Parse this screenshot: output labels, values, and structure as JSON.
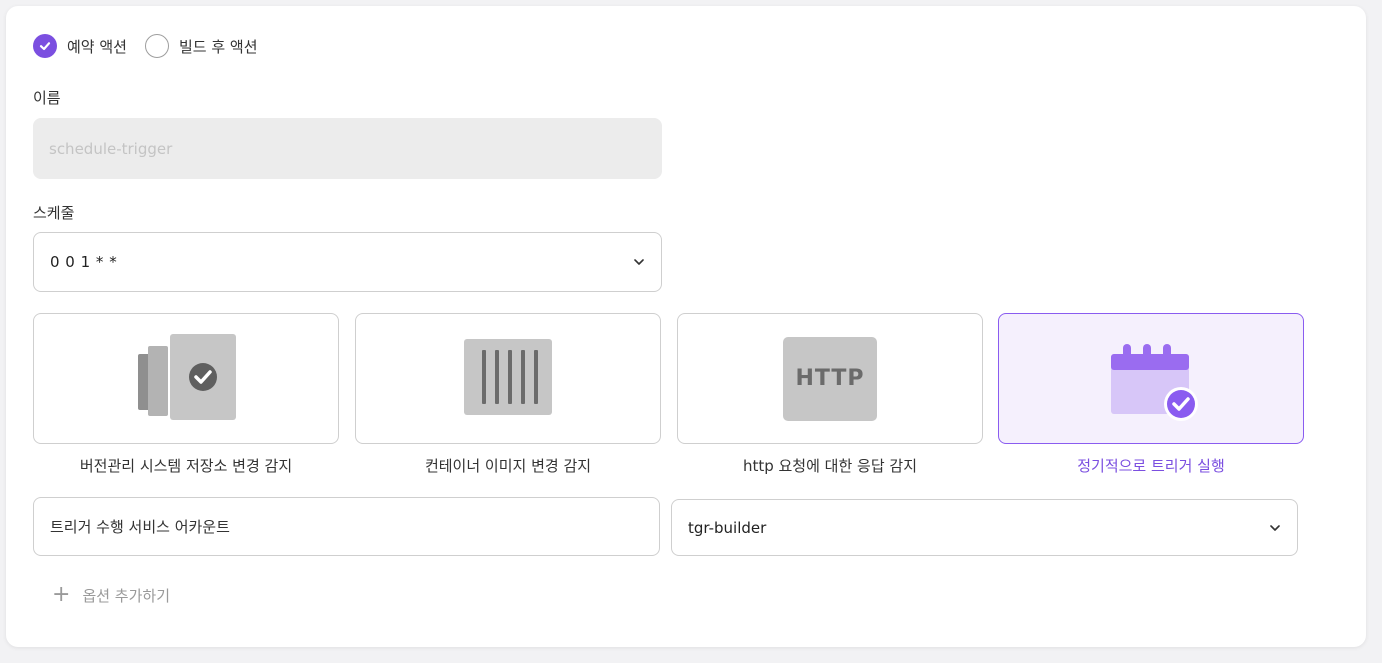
{
  "action_type": {
    "options": [
      {
        "label": "예약 액션",
        "checked": true
      },
      {
        "label": "빌드 후 액션",
        "checked": false
      }
    ]
  },
  "name_field": {
    "label": "이름",
    "placeholder": "schedule-trigger"
  },
  "schedule_field": {
    "label": "스케줄",
    "value": "0 0 1 * *"
  },
  "trigger_types": [
    {
      "label": "버전관리 시스템 저장소 변경 감지",
      "icon": "vcs-repo-icon",
      "selected": false
    },
    {
      "label": "컨테이너 이미지 변경 감지",
      "icon": "container-image-icon",
      "selected": false
    },
    {
      "label": "http 요청에 대한 응답 감지",
      "icon": "http-icon",
      "icon_text": "HTTP",
      "selected": false
    },
    {
      "label": "정기적으로 트리거 실행",
      "icon": "calendar-check-icon",
      "selected": true
    }
  ],
  "service_account": {
    "label": "트리거 수행 서비스 어카운트",
    "value": "tgr-builder"
  },
  "add_option": {
    "label": "옵션 추가하기"
  },
  "colors": {
    "accent": "#7b4fe0",
    "selected_bg": "#f5f0fd",
    "border": "#cfcfcf",
    "disabled_bg": "#ececec"
  }
}
